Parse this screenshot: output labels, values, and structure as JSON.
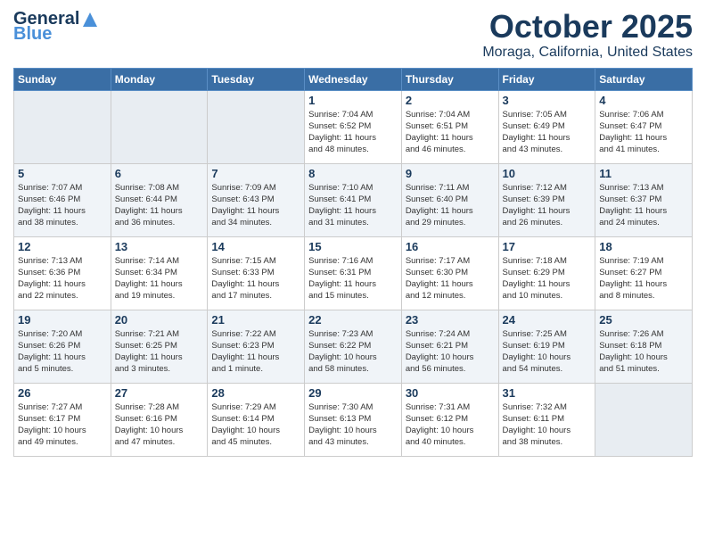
{
  "logo": {
    "general": "General",
    "blue": "Blue",
    "tagline": ""
  },
  "title": "October 2025",
  "subtitle": "Moraga, California, United States",
  "days_of_week": [
    "Sunday",
    "Monday",
    "Tuesday",
    "Wednesday",
    "Thursday",
    "Friday",
    "Saturday"
  ],
  "weeks": [
    [
      {
        "day": "",
        "info": ""
      },
      {
        "day": "",
        "info": ""
      },
      {
        "day": "",
        "info": ""
      },
      {
        "day": "1",
        "info": "Sunrise: 7:04 AM\nSunset: 6:52 PM\nDaylight: 11 hours\nand 48 minutes."
      },
      {
        "day": "2",
        "info": "Sunrise: 7:04 AM\nSunset: 6:51 PM\nDaylight: 11 hours\nand 46 minutes."
      },
      {
        "day": "3",
        "info": "Sunrise: 7:05 AM\nSunset: 6:49 PM\nDaylight: 11 hours\nand 43 minutes."
      },
      {
        "day": "4",
        "info": "Sunrise: 7:06 AM\nSunset: 6:47 PM\nDaylight: 11 hours\nand 41 minutes."
      }
    ],
    [
      {
        "day": "5",
        "info": "Sunrise: 7:07 AM\nSunset: 6:46 PM\nDaylight: 11 hours\nand 38 minutes."
      },
      {
        "day": "6",
        "info": "Sunrise: 7:08 AM\nSunset: 6:44 PM\nDaylight: 11 hours\nand 36 minutes."
      },
      {
        "day": "7",
        "info": "Sunrise: 7:09 AM\nSunset: 6:43 PM\nDaylight: 11 hours\nand 34 minutes."
      },
      {
        "day": "8",
        "info": "Sunrise: 7:10 AM\nSunset: 6:41 PM\nDaylight: 11 hours\nand 31 minutes."
      },
      {
        "day": "9",
        "info": "Sunrise: 7:11 AM\nSunset: 6:40 PM\nDaylight: 11 hours\nand 29 minutes."
      },
      {
        "day": "10",
        "info": "Sunrise: 7:12 AM\nSunset: 6:39 PM\nDaylight: 11 hours\nand 26 minutes."
      },
      {
        "day": "11",
        "info": "Sunrise: 7:13 AM\nSunset: 6:37 PM\nDaylight: 11 hours\nand 24 minutes."
      }
    ],
    [
      {
        "day": "12",
        "info": "Sunrise: 7:13 AM\nSunset: 6:36 PM\nDaylight: 11 hours\nand 22 minutes."
      },
      {
        "day": "13",
        "info": "Sunrise: 7:14 AM\nSunset: 6:34 PM\nDaylight: 11 hours\nand 19 minutes."
      },
      {
        "day": "14",
        "info": "Sunrise: 7:15 AM\nSunset: 6:33 PM\nDaylight: 11 hours\nand 17 minutes."
      },
      {
        "day": "15",
        "info": "Sunrise: 7:16 AM\nSunset: 6:31 PM\nDaylight: 11 hours\nand 15 minutes."
      },
      {
        "day": "16",
        "info": "Sunrise: 7:17 AM\nSunset: 6:30 PM\nDaylight: 11 hours\nand 12 minutes."
      },
      {
        "day": "17",
        "info": "Sunrise: 7:18 AM\nSunset: 6:29 PM\nDaylight: 11 hours\nand 10 minutes."
      },
      {
        "day": "18",
        "info": "Sunrise: 7:19 AM\nSunset: 6:27 PM\nDaylight: 11 hours\nand 8 minutes."
      }
    ],
    [
      {
        "day": "19",
        "info": "Sunrise: 7:20 AM\nSunset: 6:26 PM\nDaylight: 11 hours\nand 5 minutes."
      },
      {
        "day": "20",
        "info": "Sunrise: 7:21 AM\nSunset: 6:25 PM\nDaylight: 11 hours\nand 3 minutes."
      },
      {
        "day": "21",
        "info": "Sunrise: 7:22 AM\nSunset: 6:23 PM\nDaylight: 11 hours\nand 1 minute."
      },
      {
        "day": "22",
        "info": "Sunrise: 7:23 AM\nSunset: 6:22 PM\nDaylight: 10 hours\nand 58 minutes."
      },
      {
        "day": "23",
        "info": "Sunrise: 7:24 AM\nSunset: 6:21 PM\nDaylight: 10 hours\nand 56 minutes."
      },
      {
        "day": "24",
        "info": "Sunrise: 7:25 AM\nSunset: 6:19 PM\nDaylight: 10 hours\nand 54 minutes."
      },
      {
        "day": "25",
        "info": "Sunrise: 7:26 AM\nSunset: 6:18 PM\nDaylight: 10 hours\nand 51 minutes."
      }
    ],
    [
      {
        "day": "26",
        "info": "Sunrise: 7:27 AM\nSunset: 6:17 PM\nDaylight: 10 hours\nand 49 minutes."
      },
      {
        "day": "27",
        "info": "Sunrise: 7:28 AM\nSunset: 6:16 PM\nDaylight: 10 hours\nand 47 minutes."
      },
      {
        "day": "28",
        "info": "Sunrise: 7:29 AM\nSunset: 6:14 PM\nDaylight: 10 hours\nand 45 minutes."
      },
      {
        "day": "29",
        "info": "Sunrise: 7:30 AM\nSunset: 6:13 PM\nDaylight: 10 hours\nand 43 minutes."
      },
      {
        "day": "30",
        "info": "Sunrise: 7:31 AM\nSunset: 6:12 PM\nDaylight: 10 hours\nand 40 minutes."
      },
      {
        "day": "31",
        "info": "Sunrise: 7:32 AM\nSunset: 6:11 PM\nDaylight: 10 hours\nand 38 minutes."
      },
      {
        "day": "",
        "info": ""
      }
    ]
  ]
}
